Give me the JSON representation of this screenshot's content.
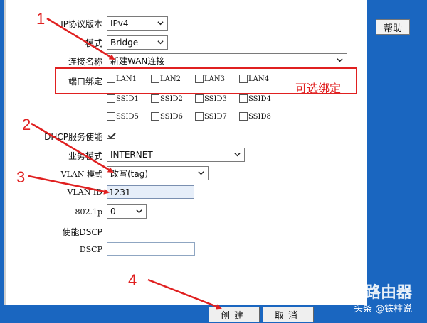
{
  "help_button": "帮助",
  "form": {
    "ip_version": {
      "label": "IP协议版本",
      "value": "IPv4"
    },
    "mode": {
      "label": "模式",
      "value": "Bridge"
    },
    "connection_name": {
      "label": "连接名称",
      "value": "新建WAN连接"
    },
    "port_binding": {
      "label": "端口绑定",
      "ports": [
        "LAN1",
        "LAN2",
        "LAN3",
        "LAN4",
        "SSID1",
        "SSID2",
        "SSID3",
        "SSID4",
        "SSID5",
        "SSID6",
        "SSID7",
        "SSID8"
      ]
    },
    "dhcp": {
      "label": "DHCP服务使能",
      "checked": true
    },
    "service_mode": {
      "label": "业务模式",
      "value": "INTERNET"
    },
    "vlan_mode": {
      "label": "VLAN 模式",
      "value": "改写(tag)"
    },
    "vlan_id": {
      "label": "VLAN ID",
      "value": "1231"
    },
    "p8021": {
      "label": "802.1p",
      "value": "0"
    },
    "dscp_enable": {
      "label": "使能DSCP",
      "checked": false
    },
    "dscp": {
      "label": "DSCP",
      "value": ""
    }
  },
  "buttons": {
    "create": "创建",
    "cancel": "取消"
  },
  "annotations": {
    "optional_binding": "可选绑定",
    "numbers": [
      "1",
      "2",
      "3",
      "4"
    ]
  },
  "watermark": {
    "brand": "路由器",
    "author": "头条 @铁柱说"
  },
  "colors": {
    "frame": "#1a66c0",
    "annotation": "#e02020"
  }
}
